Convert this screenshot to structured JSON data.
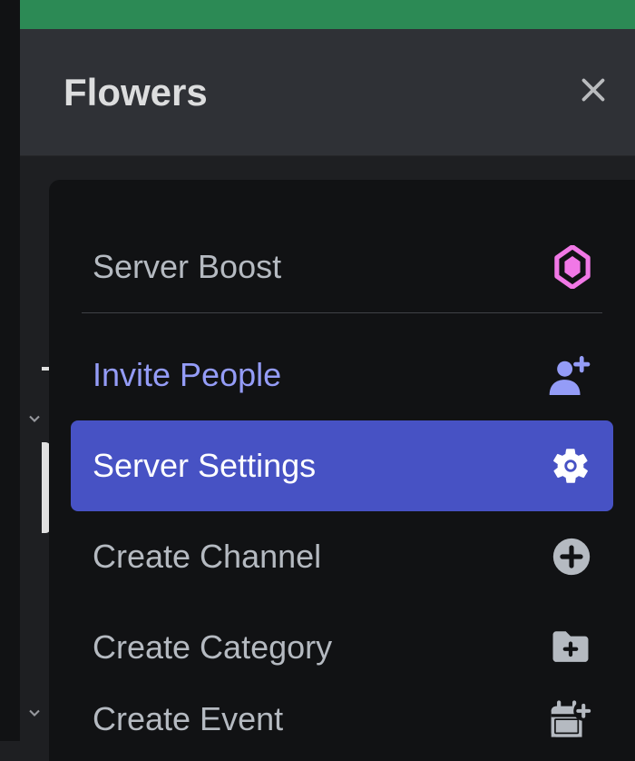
{
  "header": {
    "title": "Flowers"
  },
  "menu": {
    "boost": "Server Boost",
    "invite": "Invite People",
    "settings": "Server Settings",
    "createChannel": "Create Channel",
    "createCategory": "Create Category",
    "createEvent": "Create Event"
  }
}
